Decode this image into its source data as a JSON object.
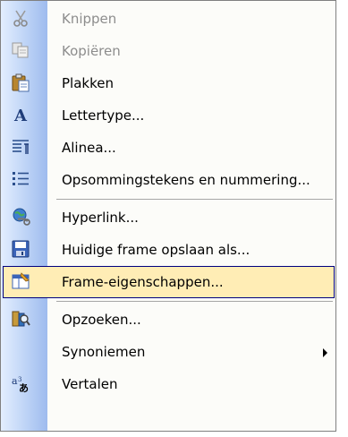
{
  "menu": {
    "items": [
      {
        "label": "Knippen",
        "icon": "scissors-icon",
        "enabled": false
      },
      {
        "label": "Kopiëren",
        "icon": "copy-icon",
        "enabled": false
      },
      {
        "label": "Plakken",
        "icon": "paste-icon",
        "enabled": true
      },
      {
        "label": "Lettertype...",
        "icon": "font-icon",
        "enabled": true
      },
      {
        "label": "Alinea...",
        "icon": "paragraph-icon",
        "enabled": true
      },
      {
        "label": "Opsommingstekens en nummering...",
        "icon": "bullets-icon",
        "enabled": true
      },
      {
        "label": "Hyperlink...",
        "icon": "hyperlink-icon",
        "enabled": true
      },
      {
        "label": "Huidige frame opslaan als...",
        "icon": "save-icon",
        "enabled": true
      },
      {
        "label": "Frame-eigenschappen...",
        "icon": "frame-properties-icon",
        "enabled": true,
        "highlighted": true
      },
      {
        "label": "Opzoeken...",
        "icon": "research-icon",
        "enabled": true
      },
      {
        "label": "Synoniemen",
        "icon": "",
        "enabled": true,
        "submenu": true
      },
      {
        "label": "Vertalen",
        "icon": "translate-icon",
        "enabled": true
      }
    ]
  },
  "colors": {
    "highlight_fill": "#ffedb5",
    "highlight_border": "#000080",
    "disabled_text": "#8d8d8d",
    "gutter_light": "#e3eefe",
    "gutter_dark": "#9ebbee"
  }
}
